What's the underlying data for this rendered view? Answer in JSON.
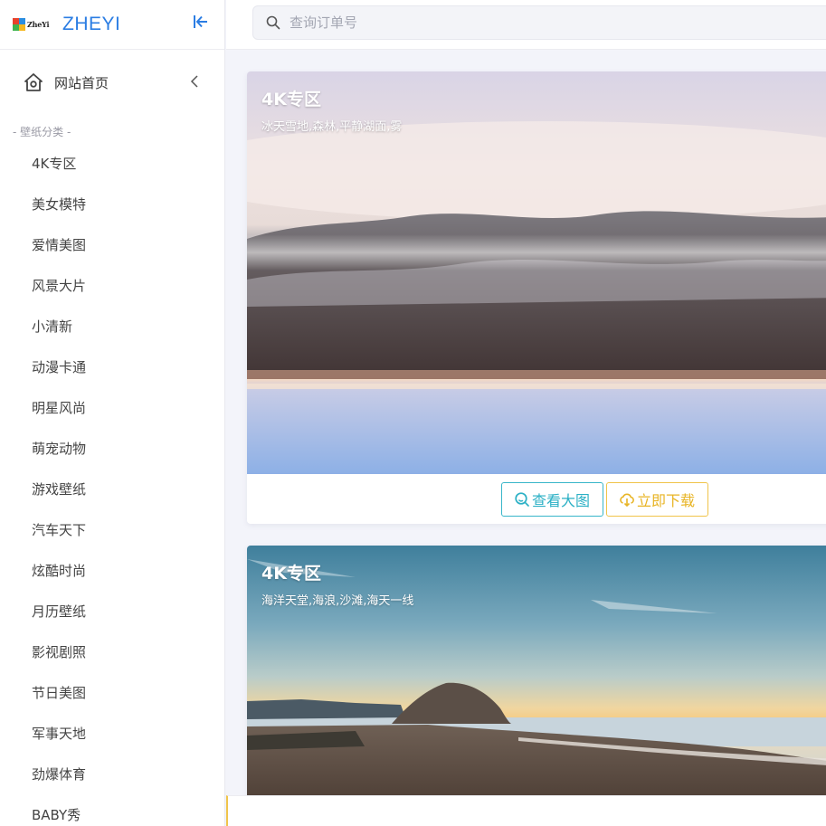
{
  "brand": {
    "logo_text": "ZheYi",
    "name": "ZHEYI",
    "accent_color": "#2b7de3"
  },
  "sidebar": {
    "home_label": "网站首页",
    "group_title": "- 壁纸分类 -",
    "items": [
      {
        "label": "4K专区"
      },
      {
        "label": "美女模特"
      },
      {
        "label": "爱情美图"
      },
      {
        "label": "风景大片"
      },
      {
        "label": "小清新"
      },
      {
        "label": "动漫卡通"
      },
      {
        "label": "明星风尚"
      },
      {
        "label": "萌宠动物"
      },
      {
        "label": "游戏壁纸"
      },
      {
        "label": "汽车天下"
      },
      {
        "label": "炫酷时尚"
      },
      {
        "label": "月历壁纸"
      },
      {
        "label": "影视剧照"
      },
      {
        "label": "节日美图"
      },
      {
        "label": "军事天地"
      },
      {
        "label": "劲爆体育"
      },
      {
        "label": "BABY秀"
      }
    ]
  },
  "search": {
    "placeholder": "查询订单号",
    "value": ""
  },
  "cards": [
    {
      "title": "4K专区",
      "subtitle": "冰天雪地,森林,平静湖面,雾",
      "view_label": "查看大图",
      "download_label": "立即下载"
    },
    {
      "title": "4K专区",
      "subtitle": "海洋天堂,海浪,沙滩,海天一线"
    }
  ],
  "colors": {
    "view_button": "#2bb0c5",
    "download_button": "#e8b424"
  }
}
